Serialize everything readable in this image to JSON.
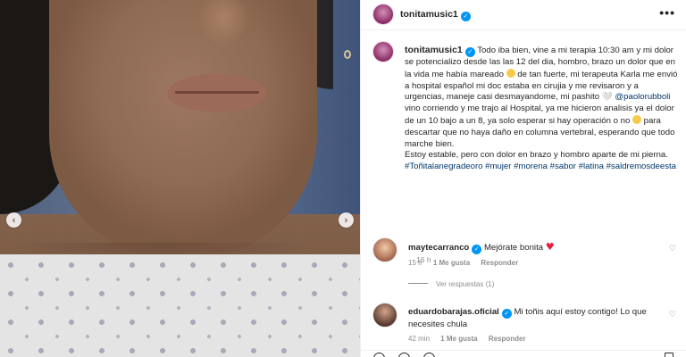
{
  "post": {
    "username": "tonitamusic1",
    "more_label": "•••",
    "nav_prev": "‹",
    "nav_next": "›"
  },
  "caption": {
    "username": "tonitamusic1",
    "text_part1": "Todo iba bien, vine a mi terapia 10:30 am y mi dolor se potencializo desde las las 12 del dia, hombro, brazo un dolor que en la vida me había mareado",
    "text_part2": "de tan fuerte, mi terapeuta Karla me envió a hospital español mi doc estaba en cirujia y me revisaron y a urgencias, maneje casi desmayandome, mi pashito",
    "heart_glyph": "🤍",
    "mention": "@paolorubboli",
    "text_part3": "vino corriendo y me trajo al Hospital, ya me hicieron analisis ya el dolor de un 10 bajo a un 8, ya solo esperar si hay operación o no",
    "text_part4": "para descartar que no haya daño en columna vertebral, esperando que todo marche bien.",
    "text_part5": "Estoy estable, pero con dolor en brazo y hombro aparte de mi pierna.",
    "hashtags": "#Toñitalanegradeoro #mujer #morena #sabor #latina #saldremosdeesta",
    "age": "16 h"
  },
  "comments": [
    {
      "username": "maytecarranco",
      "text": "Mejórate bonita",
      "heart": "♥",
      "time": "15 h",
      "likes": "1 Me gusta",
      "reply": "Responder",
      "like_icon": "♡"
    },
    {
      "username": "eduardobarajas.oficial",
      "text": "Mi toñis aquí estoy contigo! Lo que necesites chula",
      "time": "42 min",
      "likes": "1 Me gusta",
      "reply": "Responder",
      "like_icon": "♡"
    }
  ],
  "replies_label": "Ver respuestas (1)",
  "colors": {
    "link": "#00376b",
    "verified": "#0095f6",
    "muted": "#8e8e8e",
    "heart": "#e41e3f"
  }
}
